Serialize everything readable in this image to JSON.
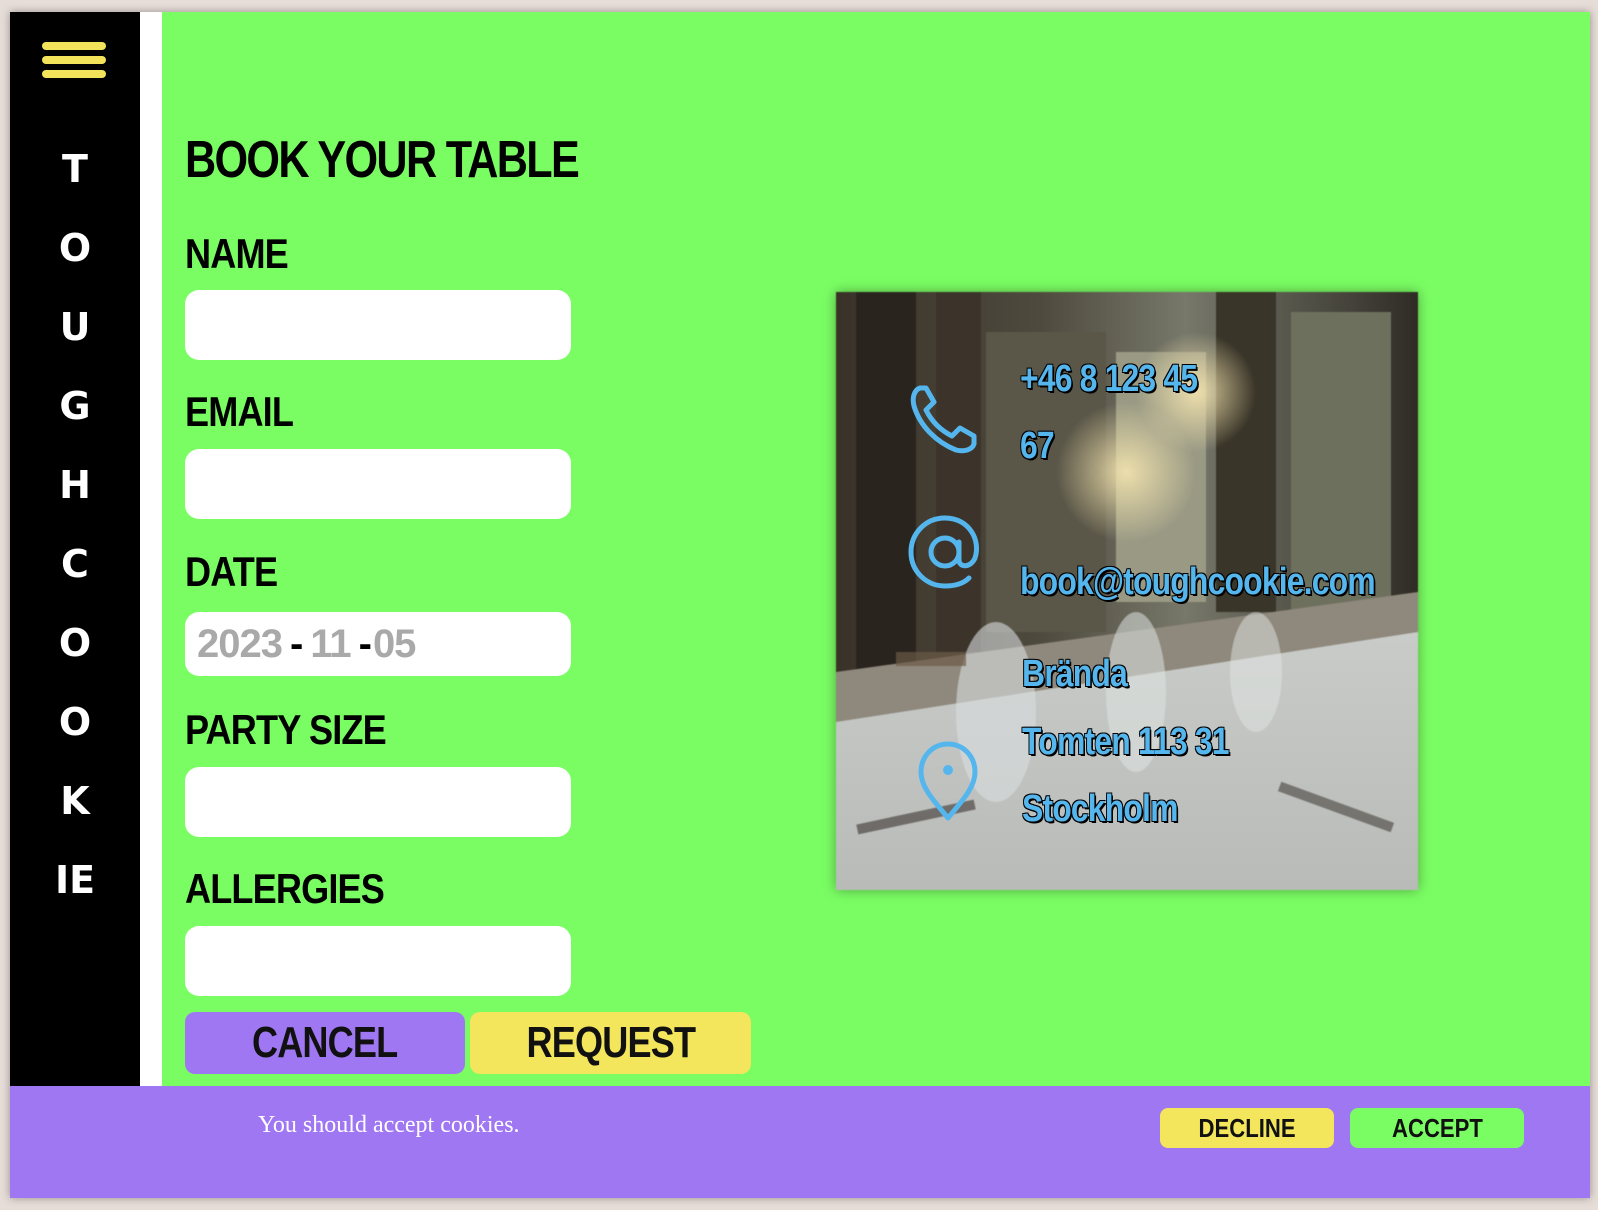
{
  "sidebar": {
    "brand": "TOUGHCOOKIE"
  },
  "form": {
    "title": "BOOK YOUR TABLE",
    "name_label": "NAME",
    "name_value": "",
    "email_label": "EMAIL",
    "email_value": "",
    "date_label": "DATE",
    "date_year": "2023",
    "date_month": "11",
    "date_day": "05",
    "date_separator": "-",
    "party_label": "PARTY SIZE",
    "party_value": "",
    "allergies_label": "ALLERGIES",
    "allergies_value": "",
    "cancel_label": "CANCEL",
    "request_label": "REQUEST"
  },
  "contact": {
    "phone_line1": "+46 8 123 45",
    "phone_line2": "67",
    "email": "book@toughcookie.com",
    "address_line1": "Brända",
    "address_line2": "Tomten 113 31",
    "address_line3": "Stockholm",
    "icons": [
      "phone-icon",
      "at-sign-icon",
      "location-pin-icon"
    ]
  },
  "cookie_banner": {
    "message": "You should accept cookies.",
    "decline_label": "DECLINE",
    "accept_label": "ACCEPT"
  },
  "colors": {
    "background": "#7afd63",
    "sidebar": "#000000",
    "menu_icon": "#f2e35a",
    "cancel_button": "#a077f2",
    "request_button": "#f3e55c",
    "contact_text": "#55b6ee",
    "cookie_bar": "#a077f2"
  }
}
